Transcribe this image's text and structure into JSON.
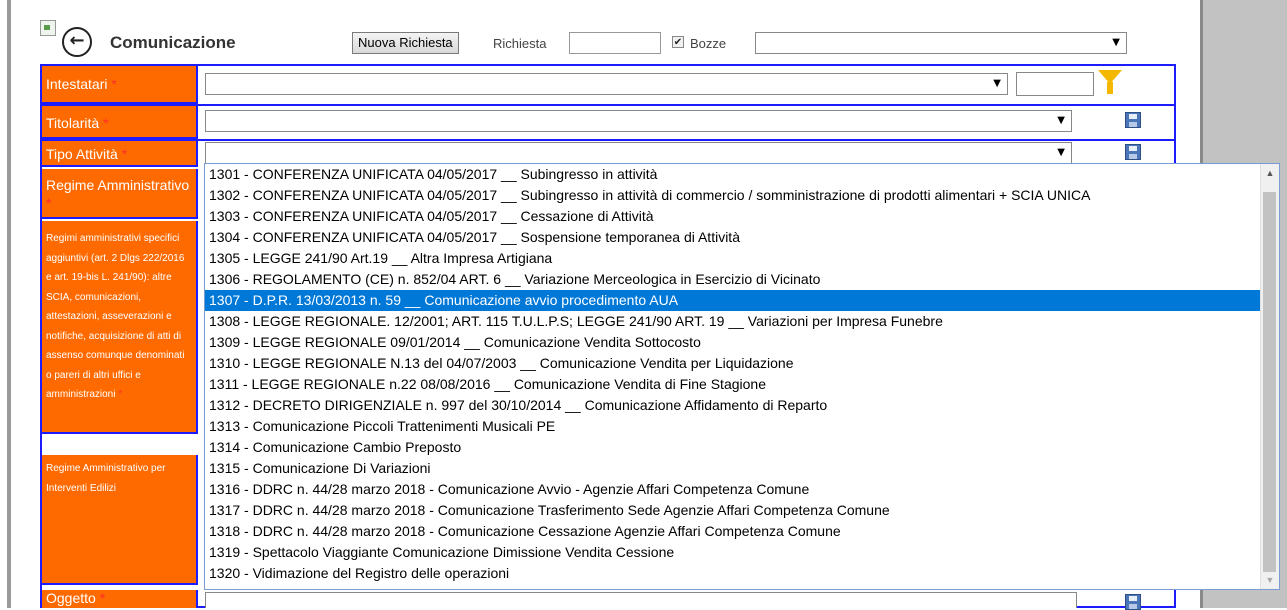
{
  "header": {
    "title": "Comunicazione",
    "new_request_button": "Nuova Richiesta",
    "request_label": "Richiesta",
    "request_value": "",
    "drafts_label": "Bozze",
    "drafts_checked": true,
    "top_select_value": ""
  },
  "form": {
    "intestatari": {
      "label": "Intestatari",
      "required": "*",
      "select_value": "",
      "filter_value": ""
    },
    "titolarita": {
      "label": "Titolarità",
      "required": "*",
      "select_value": ""
    },
    "tipo_attivita": {
      "label": "Tipo Attività",
      "required": "*",
      "select_value": ""
    },
    "regime_amministrativo": {
      "label": "Regime Amministrativo",
      "required": "*"
    },
    "regimi_aggiuntivi": {
      "label": "Regimi amministrativi specifici aggiuntivi (art. 2 Dlgs 222/2016 e art. 19-bis L. 241/90): altre SCIA, comunicazioni, attestazioni, asseverazioni e notifiche, acquisizione di atti di assenso comunque denominati o pareri di altri uffici e amministrazioni",
      "required": "*"
    },
    "regime_edilizi": {
      "label": "Regime Amministrativo per Interventi Edilizi"
    },
    "oggetto": {
      "label": "Oggetto",
      "required": "*"
    }
  },
  "dropdown": {
    "selected_index": 6,
    "options": [
      "1301 - CONFERENZA UNIFICATA 04/05/2017 __ Subingresso in attività",
      "1302 - CONFERENZA UNIFICATA 04/05/2017 __ Subingresso in attività di commercio / somministrazione di prodotti alimentari + SCIA UNICA",
      "1303 - CONFERENZA UNIFICATA 04/05/2017 __ Cessazione di Attività",
      "1304 - CONFERENZA UNIFICATA 04/05/2017 __ Sospensione temporanea di Attività",
      "1305 - LEGGE 241/90 Art.19 __ Altra Impresa Artigiana",
      "1306 - REGOLAMENTO (CE) n. 852/04 ART. 6 __ Variazione Merceologica in Esercizio di Vicinato",
      "1307 - D.P.R. 13/03/2013 n. 59 __ Comunicazione avvio procedimento AUA",
      "1308 - LEGGE REGIONALE. 12/2001; ART. 115 T.U.L.P.S; LEGGE 241/90 ART. 19 __ Variazioni per Impresa Funebre",
      "1309 - LEGGE REGIONALE 09/01/2014 __ Comunicazione Vendita Sottocosto",
      "1310 - LEGGE REGIONALE N.13 del 04/07/2003 __ Comunicazione Vendita per Liquidazione",
      "1311 - LEGGE REGIONALE n.22 08/08/2016 __ Comunicazione Vendita di Fine Stagione",
      "1312 - DECRETO DIRIGENZIALE n. 997 del 30/10/2014 __ Comunicazione Affidamento di Reparto",
      "1313 - Comunicazione Piccoli Trattenimenti Musicali PE",
      "1314 - Comunicazione Cambio Preposto",
      "1315 - Comunicazione Di Variazioni",
      "1316 - DDRC n. 44/28 marzo 2018 - Comunicazione Avvio - Agenzie Affari Competenza Comune",
      "1317 - DDRC n. 44/28 marzo 2018 - Comunicazione Trasferimento Sede Agenzie Affari Competenza Comune",
      "1318 - DDRC n. 44/28 marzo 2018 - Comunicazione Cessazione Agenzie Affari Competenza Comune",
      "1319 - Spettacolo Viaggiante Comunicazione Dimissione Vendita Cessione",
      "1320 - Vidimazione del Registro delle operazioni"
    ]
  },
  "colors": {
    "label_bg": "#ff6a00",
    "border": "#1c1cff",
    "selected_option": "#0078d7"
  },
  "icons": {
    "back": "back-arrow-icon",
    "filter": "filter-icon",
    "save": "save-icon",
    "broken_image": "broken-image-icon"
  }
}
